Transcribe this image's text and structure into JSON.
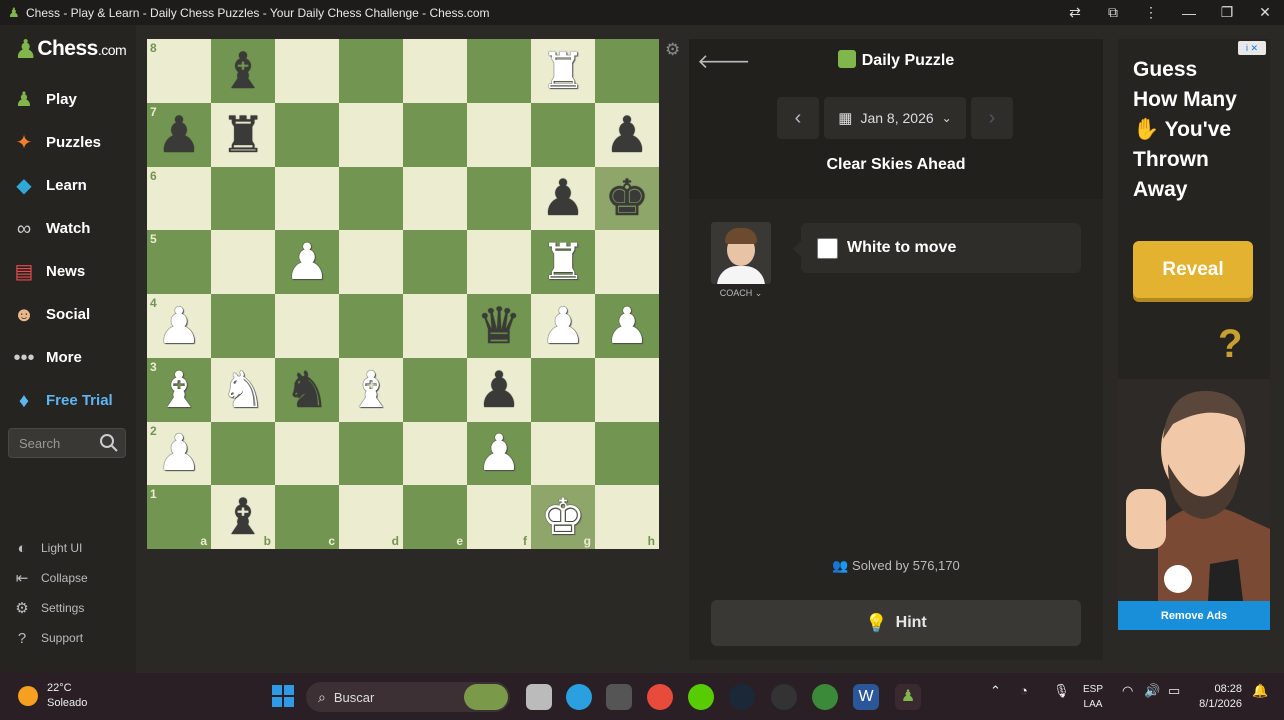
{
  "window": {
    "title": "Chess - Play & Learn - Daily Chess Puzzles - Your Daily Chess Challenge - Chess.com",
    "controls": [
      "translate-icon",
      "extensions-icon",
      "more-icon",
      "minimize-icon",
      "maximize-icon",
      "close-icon"
    ]
  },
  "sidebar": {
    "brand": "Chess",
    "brand_suffix": ".com",
    "items": [
      {
        "label": "Play",
        "icon": "play-board-icon"
      },
      {
        "label": "Puzzles",
        "icon": "puzzle-icon"
      },
      {
        "label": "Learn",
        "icon": "learn-icon"
      },
      {
        "label": "Watch",
        "icon": "binoculars-icon"
      },
      {
        "label": "News",
        "icon": "news-icon"
      },
      {
        "label": "Social",
        "icon": "social-icon"
      },
      {
        "label": "More",
        "icon": "more-dots-icon"
      },
      {
        "label": "Free Trial",
        "icon": "diamond-icon"
      }
    ],
    "search_placeholder": "Search",
    "bottom_items": [
      {
        "label": "Light UI",
        "icon": "contrast-icon"
      },
      {
        "label": "Collapse",
        "icon": "collapse-icon"
      },
      {
        "label": "Settings",
        "icon": "gear-icon"
      },
      {
        "label": "Support",
        "icon": "help-icon"
      }
    ]
  },
  "board": {
    "ranks": [
      "8",
      "7",
      "6",
      "5",
      "4",
      "3",
      "2",
      "1"
    ],
    "files": [
      "a",
      "b",
      "c",
      "d",
      "e",
      "f",
      "g",
      "h"
    ],
    "pieces": {
      "b8": "bB",
      "g8": "wR",
      "a7": "bP",
      "b7": "bR",
      "h7": "bP",
      "g6": "bP",
      "h6": "bK",
      "c5": "wP",
      "g5": "wR",
      "a4": "wP",
      "f4": "bQ",
      "g4": "wP",
      "h4": "wP",
      "a3": "wB",
      "b3": "wN",
      "c3": "bN",
      "d3": "wB",
      "f3": "bP",
      "a2": "wP",
      "f2": "wP",
      "b1": "bB",
      "g1": "wK"
    },
    "highlighted": [
      "h6",
      "g1"
    ]
  },
  "panel": {
    "title": "Daily Puzzle",
    "date": "Jan 8, 2026",
    "puzzle_name": "Clear Skies Ahead",
    "coach_label": "COACH",
    "to_move": "White to move",
    "solved_by": "Solved by 576,170",
    "hint_label": "Hint"
  },
  "ad": {
    "badge": "i ✕",
    "line1": "Guess",
    "line2": "How Many",
    "line3": "You've",
    "line4": "Thrown",
    "line5": "Away",
    "cta": "Reveal",
    "remove": "Remove Ads"
  },
  "taskbar": {
    "temp": "22°C",
    "condition": "Soleado",
    "search": "Buscar",
    "lang1": "ESP",
    "lang2": "LAA",
    "time": "08:28",
    "date": "8/1/2026"
  }
}
